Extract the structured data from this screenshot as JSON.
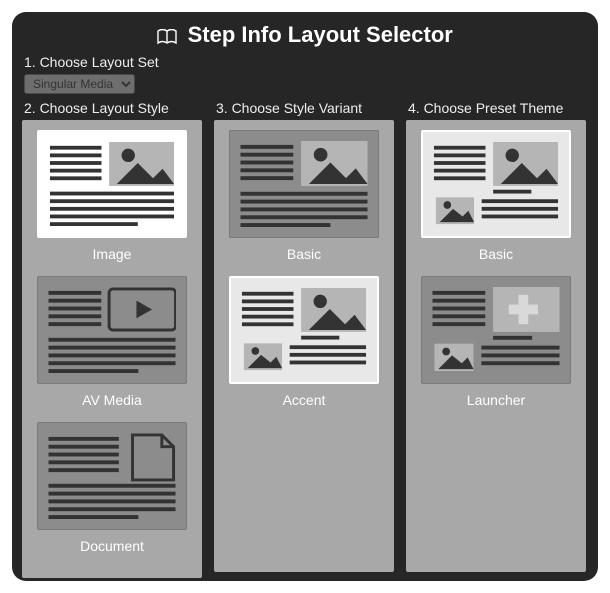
{
  "title": "Step Info Layout Selector",
  "step1": {
    "label": "1. Choose Layout Set"
  },
  "layoutSet": {
    "selected": "Singular Media"
  },
  "columns": [
    {
      "header": "2. Choose Layout Style",
      "items": [
        {
          "label": "Image",
          "selected": true,
          "thumb": "image"
        },
        {
          "label": "AV Media",
          "selected": false,
          "thumb": "av"
        },
        {
          "label": "Document",
          "selected": false,
          "thumb": "document"
        }
      ]
    },
    {
      "header": "3. Choose Style Variant",
      "items": [
        {
          "label": "Basic",
          "selected": false,
          "thumb": "variant-basic"
        },
        {
          "label": "Accent",
          "selected": true,
          "thumb": "variant-accent",
          "accent": true
        }
      ]
    },
    {
      "header": "4. Choose Preset Theme",
      "items": [
        {
          "label": "Basic",
          "selected": true,
          "thumb": "theme-basic",
          "accent": true
        },
        {
          "label": "Launcher",
          "selected": false,
          "thumb": "theme-launcher"
        }
      ]
    }
  ]
}
